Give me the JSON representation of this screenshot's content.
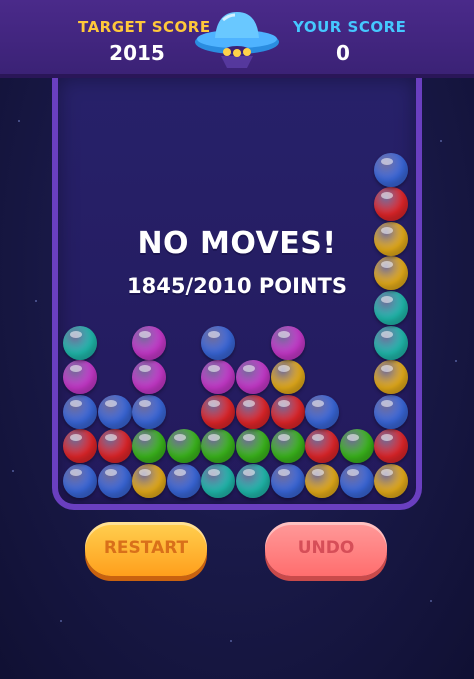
{
  "header": {
    "target_label": "TARGET SCORE",
    "target_value": "2015",
    "your_label": "YOUR SCORE",
    "your_value": "0"
  },
  "message": {
    "title": "NO MOVES!",
    "points": "1845/2010 POINTS"
  },
  "buttons": {
    "restart": "RESTART",
    "undo": "UNDO"
  },
  "colors": {
    "blue": "#3d6ee8",
    "red": "#f0282c",
    "green": "#3fc41e",
    "yellow": "#f5b81c",
    "teal": "#22c6b8",
    "magenta": "#d43cd8"
  },
  "board": {
    "columns": [
      [
        "blue",
        "red",
        "blue",
        "magenta",
        "teal"
      ],
      [
        "blue",
        "red",
        "blue"
      ],
      [
        "yellow",
        "green",
        "blue",
        "magenta",
        "magenta"
      ],
      [
        "blue",
        "green"
      ],
      [
        "teal",
        "green",
        "red",
        "magenta",
        "blue"
      ],
      [
        "teal",
        "green",
        "red",
        "magenta"
      ],
      [
        "blue",
        "green",
        "red",
        "yellow",
        "magenta"
      ],
      [
        "yellow",
        "red",
        "blue"
      ],
      [
        "blue",
        "green"
      ],
      [
        "yellow",
        "red",
        "blue",
        "yellow",
        "teal",
        "teal",
        "yellow",
        "yellow",
        "red",
        "blue"
      ]
    ]
  }
}
